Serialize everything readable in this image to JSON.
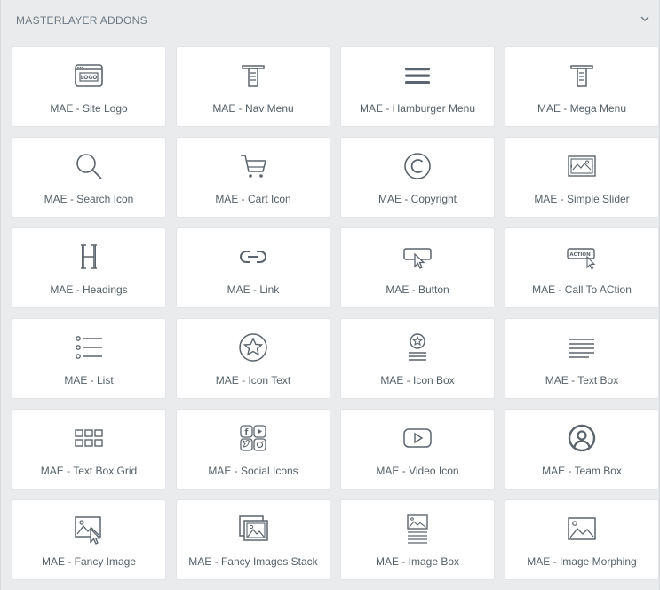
{
  "section": {
    "title": "MASTERLAYER ADDONS"
  },
  "widgets": [
    {
      "label": "MAE - Site Logo",
      "icon": "site-logo-icon"
    },
    {
      "label": "MAE - Nav Menu",
      "icon": "nav-menu-icon"
    },
    {
      "label": "MAE - Hamburger Menu",
      "icon": "hamburger-menu-icon"
    },
    {
      "label": "MAE - Mega Menu",
      "icon": "mega-menu-icon"
    },
    {
      "label": "MAE - Search Icon",
      "icon": "search-icon"
    },
    {
      "label": "MAE - Cart Icon",
      "icon": "cart-icon"
    },
    {
      "label": "MAE - Copyright",
      "icon": "copyright-icon"
    },
    {
      "label": "MAE - Simple Slider",
      "icon": "slider-icon"
    },
    {
      "label": "MAE - Headings",
      "icon": "heading-icon"
    },
    {
      "label": "MAE - Link",
      "icon": "link-icon"
    },
    {
      "label": "MAE - Button",
      "icon": "button-icon"
    },
    {
      "label": "MAE - Call To ACtion",
      "icon": "call-to-action-icon"
    },
    {
      "label": "MAE - List",
      "icon": "list-icon"
    },
    {
      "label": "MAE - Icon Text",
      "icon": "icon-text-icon"
    },
    {
      "label": "MAE - Icon Box",
      "icon": "icon-box-icon"
    },
    {
      "label": "MAE - Text Box",
      "icon": "text-box-icon"
    },
    {
      "label": "MAE - Text Box Grid",
      "icon": "text-box-grid-icon"
    },
    {
      "label": "MAE - Social Icons",
      "icon": "social-icons-icon"
    },
    {
      "label": "MAE - Video Icon",
      "icon": "video-icon"
    },
    {
      "label": "MAE - Team Box",
      "icon": "team-box-icon"
    },
    {
      "label": "MAE - Fancy Image",
      "icon": "fancy-image-icon"
    },
    {
      "label": "MAE - Fancy Images Stack",
      "icon": "fancy-images-stack-icon"
    },
    {
      "label": "MAE - Image Box",
      "icon": "image-box-icon"
    },
    {
      "label": "MAE - Image Morphing",
      "icon": "image-morphing-icon"
    }
  ],
  "colors": {
    "icon": "#5b646c",
    "label": "#556068",
    "tile_bg": "#ffffff",
    "panel_bg": "#e9ebed"
  }
}
